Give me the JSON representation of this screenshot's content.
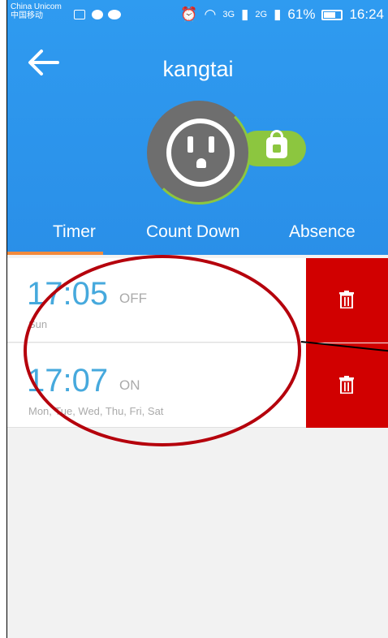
{
  "status_bar": {
    "carrier_line1": "China Unicom",
    "carrier_line2": "中国移动",
    "net1": "3G",
    "net2": "2G",
    "battery": "61%",
    "time": "16:24"
  },
  "header": {
    "title": "kangtai"
  },
  "tabs": [
    {
      "label": "Timer"
    },
    {
      "label": "Count Down"
    },
    {
      "label": "Absence"
    }
  ],
  "timers": [
    {
      "time": "17:05",
      "state": "OFF",
      "days": "Sun"
    },
    {
      "time": "17:07",
      "state": "ON",
      "days": "Mon, Tue, Wed, Thu, Fri, Sat"
    }
  ],
  "colors": {
    "header_blue": "#2f9bf0",
    "lock_green": "#8cc63f",
    "delete_red": "#d10000",
    "time_blue": "#46a9dd",
    "active_tab": "#f28a3c",
    "annotation": "#b5000c"
  }
}
